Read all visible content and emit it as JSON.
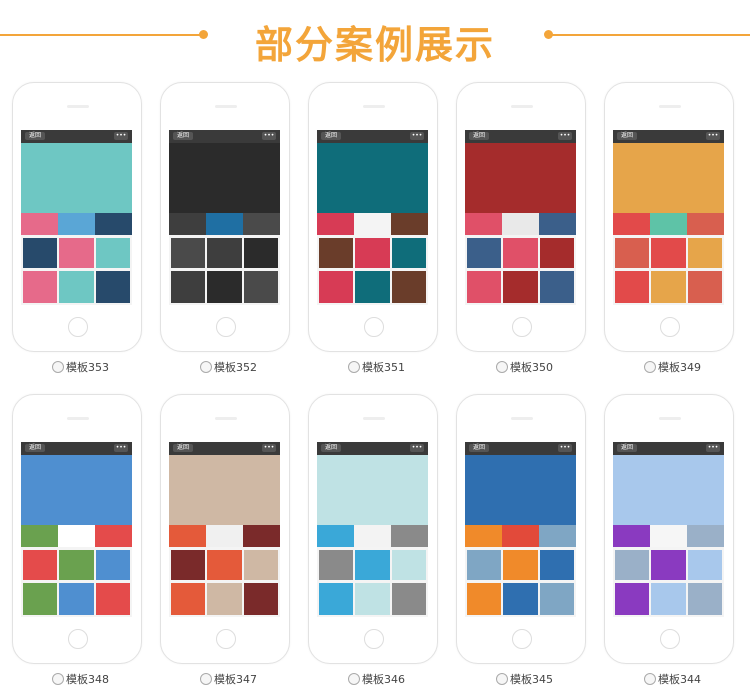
{
  "header": {
    "title": "部分案例展示"
  },
  "phone": {
    "back_label": "返回",
    "menu_label": "•••"
  },
  "templates": [
    {
      "label": "模板353",
      "theme": [
        "#6ec7c3",
        "#e66a8a",
        "#5aa6d6",
        "#274a6b"
      ]
    },
    {
      "label": "模板352",
      "theme": [
        "#2b2b2b",
        "#3e3e3e",
        "#1f6fa3",
        "#4a4a4a"
      ]
    },
    {
      "label": "模板351",
      "theme": [
        "#0f6d7a",
        "#d73b55",
        "#f4f4f4",
        "#6a3d2a"
      ]
    },
    {
      "label": "模板350",
      "theme": [
        "#a52c2c",
        "#e05068",
        "#e9e9e9",
        "#3b5f8a"
      ]
    },
    {
      "label": "模板349",
      "theme": [
        "#e6a54a",
        "#e24a4a",
        "#5ec3a7",
        "#d85f4f"
      ]
    },
    {
      "label": "模板348",
      "theme": [
        "#4f8fd0",
        "#6aa14f",
        "#ffffff",
        "#e44b4b"
      ]
    },
    {
      "label": "模板347",
      "theme": [
        "#cfb8a4",
        "#e45a3a",
        "#f0f0f0",
        "#7a2a2a"
      ]
    },
    {
      "label": "模板346",
      "theme": [
        "#bfe2e4",
        "#3aa8d8",
        "#f3f3f3",
        "#8a8a8a"
      ]
    },
    {
      "label": "模板345",
      "theme": [
        "#2f6fb0",
        "#f08a2a",
        "#e24a3a",
        "#7fa6c4"
      ]
    },
    {
      "label": "模板344",
      "theme": [
        "#a8c8ec",
        "#8a3ac0",
        "#f6f6f6",
        "#9ab0c8"
      ]
    }
  ]
}
